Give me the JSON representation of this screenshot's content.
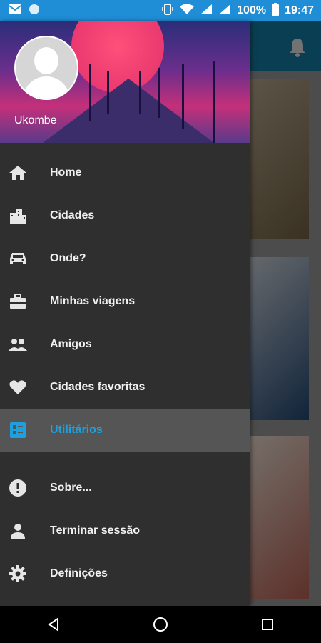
{
  "status_bar": {
    "battery_percent": "100%",
    "time": "19:47",
    "icons": [
      "mail-icon",
      "chat-bubble-icon",
      "vibrate-icon",
      "wifi-icon",
      "signal-icon",
      "signal-icon",
      "battery-icon"
    ]
  },
  "drawer": {
    "username": "Ukombe",
    "items": [
      {
        "label": "Home",
        "icon": "home-icon"
      },
      {
        "label": "Cidades",
        "icon": "city-icon"
      },
      {
        "label": "Onde?",
        "icon": "car-icon"
      },
      {
        "label": "Minhas viagens",
        "icon": "briefcase-icon"
      },
      {
        "label": "Amigos",
        "icon": "people-icon"
      },
      {
        "label": "Cidades favoritas",
        "icon": "heart-icon"
      },
      {
        "label": "Utilitários",
        "icon": "list-icon",
        "active": true
      }
    ],
    "secondary_items": [
      {
        "label": "Sobre...",
        "icon": "alert-icon"
      },
      {
        "label": "Terminar sessão",
        "icon": "person-icon"
      },
      {
        "label": "Definições",
        "icon": "gear-icon"
      }
    ]
  },
  "colors": {
    "status_bar": "#1f8ed6",
    "accent": "#1da0e0",
    "drawer_bg": "#2f2f2f",
    "active_bg": "#555555"
  }
}
